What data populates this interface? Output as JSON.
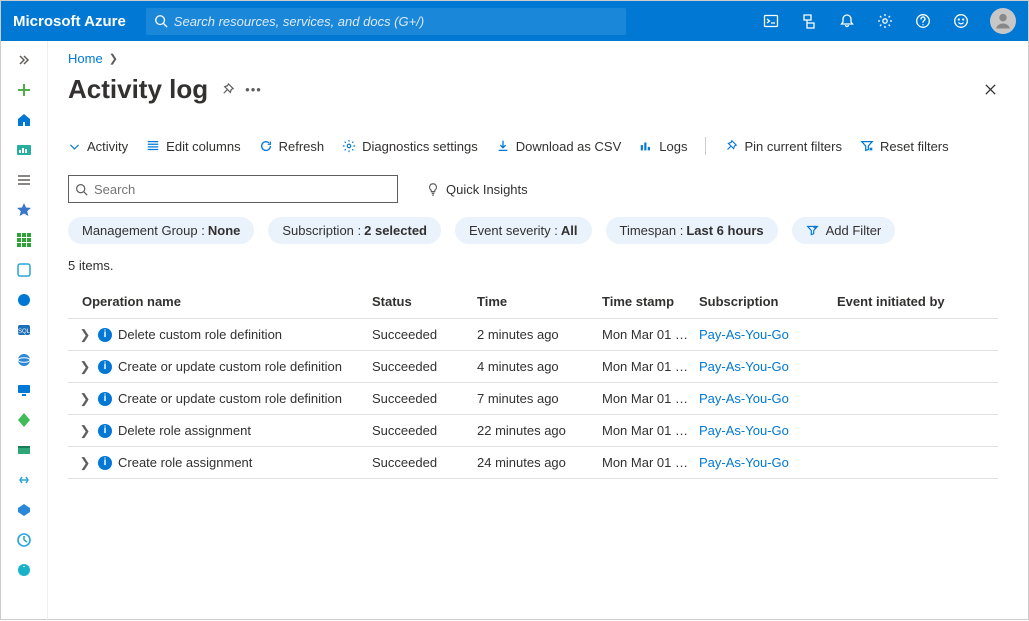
{
  "header": {
    "brand": "Microsoft Azure",
    "search_placeholder": "Search resources, services, and docs (G+/)"
  },
  "breadcrumb": {
    "home": "Home"
  },
  "page": {
    "title": "Activity log"
  },
  "toolbar": {
    "activity": "Activity",
    "edit_columns": "Edit columns",
    "refresh": "Refresh",
    "diagnostics": "Diagnostics settings",
    "download_csv": "Download as CSV",
    "logs": "Logs",
    "pin_filters": "Pin current filters",
    "reset_filters": "Reset filters"
  },
  "search": {
    "placeholder": "Search",
    "quick_insights": "Quick Insights"
  },
  "filters": {
    "mg_label": "Management Group : ",
    "mg_value": "None",
    "sub_label": "Subscription : ",
    "sub_value": "2 selected",
    "sev_label": "Event severity : ",
    "sev_value": "All",
    "ts_label": "Timespan : ",
    "ts_value": "Last 6 hours",
    "add_filter": "Add Filter"
  },
  "table": {
    "count_text": "5 items.",
    "headers": {
      "op": "Operation name",
      "status": "Status",
      "time": "Time",
      "ts": "Time stamp",
      "sub": "Subscription",
      "evt": "Event initiated by"
    },
    "rows": [
      {
        "op": "Delete custom role definition",
        "status": "Succeeded",
        "time": "2 minutes ago",
        "ts": "Mon Mar 01 …",
        "sub": "Pay-As-You-Go",
        "evt": ""
      },
      {
        "op": "Create or update custom role definition",
        "status": "Succeeded",
        "time": "4 minutes ago",
        "ts": "Mon Mar 01 …",
        "sub": "Pay-As-You-Go",
        "evt": ""
      },
      {
        "op": "Create or update custom role definition",
        "status": "Succeeded",
        "time": "7 minutes ago",
        "ts": "Mon Mar 01 …",
        "sub": "Pay-As-You-Go",
        "evt": ""
      },
      {
        "op": "Delete role assignment",
        "status": "Succeeded",
        "time": "22 minutes ago",
        "ts": "Mon Mar 01 …",
        "sub": "Pay-As-You-Go",
        "evt": ""
      },
      {
        "op": "Create role assignment",
        "status": "Succeeded",
        "time": "24 minutes ago",
        "ts": "Mon Mar 01 …",
        "sub": "Pay-As-You-Go",
        "evt": ""
      }
    ]
  }
}
